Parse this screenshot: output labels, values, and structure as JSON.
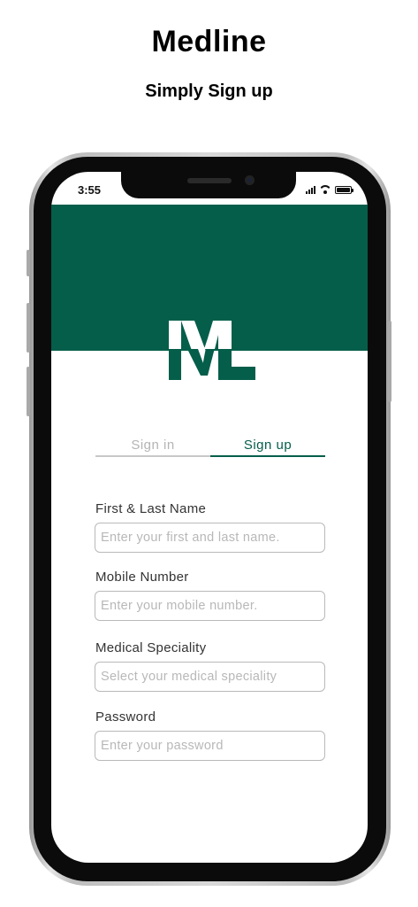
{
  "page": {
    "title": "Medline",
    "subtitle": "Simply Sign up"
  },
  "status_bar": {
    "time": "3:55",
    "icons": [
      "cellular-signal-icon",
      "wifi-icon",
      "battery-icon"
    ]
  },
  "brand": {
    "logo_letters": "ML",
    "primary_color": "#045e4a"
  },
  "tabs": [
    {
      "label": "Sign in",
      "active": false
    },
    {
      "label": "Sign up",
      "active": true
    }
  ],
  "form": {
    "name": {
      "label": "First & Last Name",
      "placeholder": "Enter your first and last name.",
      "value": ""
    },
    "mobile": {
      "label": "Mobile Number",
      "placeholder": "Enter your mobile number.",
      "value": ""
    },
    "speciality": {
      "label": "Medical Speciality",
      "placeholder": "Select your medical speciality",
      "value": ""
    },
    "password": {
      "label": "Password",
      "placeholder": "Enter your password",
      "value": ""
    }
  }
}
